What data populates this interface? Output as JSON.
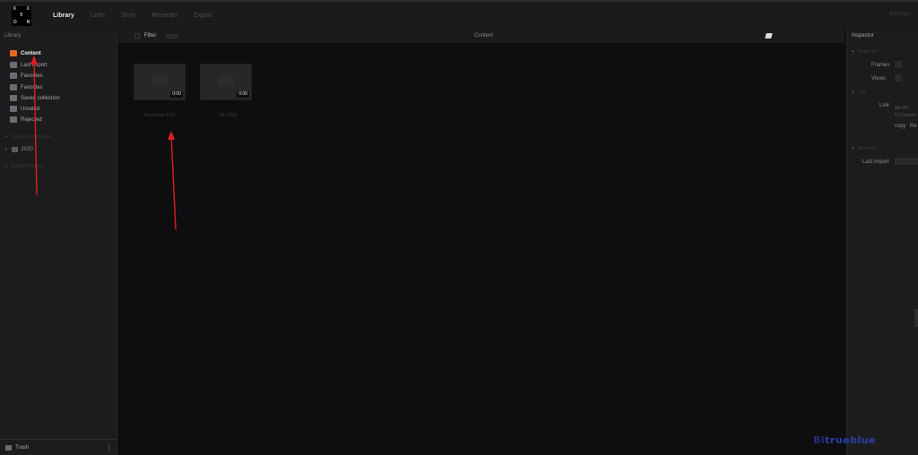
{
  "logo": {
    "letters": [
      "K",
      "",
      "X",
      "",
      "E",
      "",
      "O",
      "",
      "N"
    ]
  },
  "menu": [
    {
      "label": "Library",
      "active": true
    },
    {
      "label": "Links",
      "active": false
    },
    {
      "label": "Story",
      "active": false
    },
    {
      "label": "Recorder",
      "active": false
    },
    {
      "label": "Export",
      "active": false
    }
  ],
  "app_title": "Kinovea",
  "sidebar": {
    "header": "Library",
    "items": [
      {
        "label": "Content",
        "icon": "film-icon",
        "active": true
      },
      {
        "label": "Last import",
        "icon": "import-icon",
        "active": false
      },
      {
        "label": "Favorites",
        "icon": "favorites-icon",
        "active": false
      },
      {
        "label": "Favorites",
        "icon": "star-icon",
        "active": false
      },
      {
        "label": "Saved collection",
        "icon": "collection-icon",
        "active": false
      },
      {
        "label": "Unrated",
        "icon": "rating-icon",
        "active": false
      },
      {
        "label": "Rejected",
        "icon": "reject-icon",
        "active": false
      }
    ],
    "group1": "Local collections",
    "sub1": "2020",
    "group2": "Smart folders",
    "bottom": "Trash"
  },
  "center": {
    "filter_label": "Filter",
    "title": "Content",
    "thumbs": [
      {
        "duration": "0:00",
        "label": "Recording 0001"
      },
      {
        "duration": "0:00",
        "label": "Clip 0002"
      }
    ]
  },
  "inspector": {
    "title": "Inspector",
    "section_info": "Media info",
    "row_frames": "Frames",
    "row_views": "Views",
    "section_link": "Link",
    "row_link": "Link",
    "link_value1": "file:///C",
    "link_value2": "D:\\Content",
    "row_copy": "copy",
    "copy_value": "Re",
    "section_metadata": "Metadata",
    "row_last_import": "Last import"
  },
  "watermark": {
    "prefix": "Bi",
    "rest": "trueblue"
  },
  "colors": {
    "accent": "#e36a1f",
    "annotation": "#e11d1d",
    "background": "#0e0d0f",
    "panel": "#1c1c1e"
  }
}
